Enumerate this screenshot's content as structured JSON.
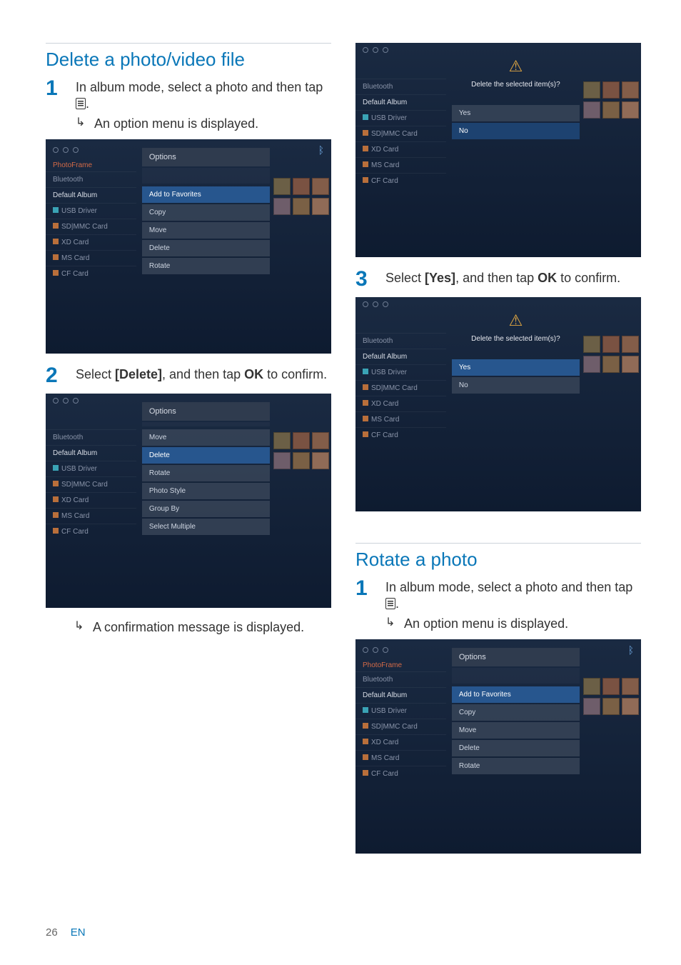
{
  "page": {
    "number": "26",
    "lang": "EN"
  },
  "left": {
    "heading": "Delete a photo/video file",
    "step1_num": "1",
    "step1_a": "In album mode, select a photo and then tap ",
    "step1_b": ".",
    "step1_result": "An option menu is displayed.",
    "step2_num": "2",
    "step2_a": "Select ",
    "step2_b": "[Delete]",
    "step2_c": ", and then tap ",
    "step2_d": "OK",
    "step2_e": " to confirm.",
    "step2_result": "A confirmation message is displayed."
  },
  "right": {
    "step3_num": "3",
    "step3_a": "Select ",
    "step3_b": "[Yes]",
    "step3_c": ", and then tap ",
    "step3_d": "OK",
    "step3_e": " to confirm.",
    "heading2": "Rotate a photo",
    "sec2_step1_num": "1",
    "sec2_step1_a": "In album mode, select a photo and then tap ",
    "sec2_step1_b": ".",
    "sec2_step1_result": "An option menu is displayed."
  },
  "shots": {
    "sidebar_title": "PhotoFrame",
    "items": [
      "Bluetooth",
      "Default Album",
      "USB Driver",
      "SD|MMC Card",
      "XD Card",
      "MS Card",
      "CF Card"
    ],
    "options_hdr": "Options",
    "menu_a": [
      "Add to Favorites",
      "Copy",
      "Move",
      "Delete",
      "Rotate"
    ],
    "menu_b": [
      "Move",
      "Delete",
      "Rotate",
      "Photo Style",
      "Group By",
      "Select Multiple"
    ],
    "dialog_ask": "Delete the selected item(s)?",
    "yes": "Yes",
    "no": "No"
  }
}
